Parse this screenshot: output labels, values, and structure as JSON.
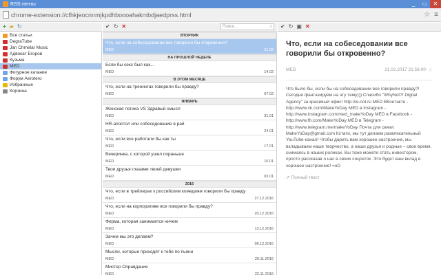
{
  "window": {
    "tab_title": "RSS-ленты",
    "controls": [
      "_",
      "▭",
      "✕"
    ]
  },
  "address": {
    "url": "chrome-extension://cfhkjeocnnmjkpdhboooahakmbdjaedprss.html"
  },
  "toolbar": {
    "search_placeholder": "Поиск..."
  },
  "colors": {
    "accent": "#5a8fd8",
    "selection": "#a7c7ef",
    "ok": "#3a9a3a",
    "danger": "#cc2b2b"
  },
  "feeds": [
    {
      "label": "Все статьи",
      "icon": "rss-icon",
      "color": "#f29a26"
    },
    {
      "label": "DegraTube",
      "icon": "youtube-icon",
      "color": "#d0312d"
    },
    {
      "label": "Jan Chmelar Music",
      "icon": "youtube-icon",
      "color": "#d0312d"
    },
    {
      "label": "Адвокат Егоров",
      "icon": "youtube-icon",
      "color": "#d0312d"
    },
    {
      "label": "Кузьма",
      "icon": "youtube-icon",
      "color": "#d0312d"
    },
    {
      "label": "MED",
      "icon": "youtube-icon",
      "color": "#d0312d"
    },
    {
      "label": "Фигурное катание",
      "icon": "folder-icon",
      "color": "#6ea8e8"
    },
    {
      "label": "Форум Aerotero",
      "icon": "folder-icon",
      "color": "#6ea8e8"
    },
    {
      "label": "Избранные",
      "icon": "star-icon",
      "color": "#e6b800"
    },
    {
      "label": "Корзина",
      "icon": "trash-icon",
      "color": "#888888"
    }
  ],
  "groups": [
    {
      "label": "ВТОРНИК",
      "items": [
        {
          "title": "Что, если на собеседовании все говорили бы откровенно?",
          "source": "MED",
          "date": "21.02"
        }
      ]
    },
    {
      "label": "НА ПРОШЛОЙ НЕДЕЛЕ",
      "items": [
        {
          "title": "Если бы секс был как...",
          "source": "MED",
          "date": "14.02"
        }
      ]
    },
    {
      "label": "В ЭТОМ МЕСЯЦЕ",
      "items": [
        {
          "title": "Что, если на тренингах говорили бы правду?",
          "source": "MED",
          "date": "07.02"
        }
      ]
    },
    {
      "label": "ЯНВАРЬ",
      "items": [
        {
          "title": "Женская логика VS Здравый смысл",
          "source": "MED",
          "date": "31.01"
        },
        {
          "title": "HR-апостол или собеседование в рай",
          "source": "MED",
          "date": "24.01"
        },
        {
          "title": "Что, если все работали бы как ты",
          "source": "MED",
          "date": "17.01"
        },
        {
          "title": "Вечеринка, с которой ушел пораньше",
          "source": "MED",
          "date": "10.01"
        },
        {
          "title": "Твои друзья глазами твоей девушки",
          "source": "MED",
          "date": "03.01"
        }
      ]
    },
    {
      "label": "2016",
      "items": [
        {
          "title": "Что, если в трейлерах к российским комедиям говорили бы правду",
          "source": "MED",
          "date": "27.12.2016"
        },
        {
          "title": "Что, если на корпоративе все говорили бы правду?",
          "source": "MED",
          "date": "20.12.2016"
        },
        {
          "title": "Фирма, которая занимается ничем",
          "source": "MED",
          "date": "13.12.2016"
        },
        {
          "title": "Зачем мы это делаем?",
          "source": "MED",
          "date": "06.12.2016"
        },
        {
          "title": "Мысли, которые приходят к тебе по пьяни",
          "source": "MED",
          "date": "29.11.2016"
        },
        {
          "title": "Мистер Оправдание",
          "source": "MED",
          "date": "22.11.2016"
        }
      ]
    }
  ],
  "article": {
    "title": "Что, если на собеседовании все говорили бы откровенно?",
    "source": "MED",
    "date": "21.02.2017 21:56:00",
    "body": "Что было бы, если бы на собеседовании все говорили правду?! Сегодня фантазируем на эту тему))) Спасибо \"WhyNot?! Digital Agency\" за красивый офис! http://w-not.ru MED ВКонтакте - http://www.vk.com/MakeYoDay MED в Instagram - http://www.instagram.com/med_makeYoDay MED в Facebook - http://www.fb.com/MakeYoDay MED в Telegram - http://www.telegram.me/makeYoDay Почта для связи: MakeYoDay@gmail.com Кстати, мы тут делаем развлекательный YouTube-канал! Чтобы дарить вам хорошее настроение, мы вкладываем наше творчество, а наши друзья и родные – свое время, снимаясь в наших роликах. Вы тоже можете стать инвестором, просто рассказав о нас в своих соцсетях. Это будет ваш вклад в хорошее настроение! =oD",
    "full_text_link": "Полный текст"
  }
}
